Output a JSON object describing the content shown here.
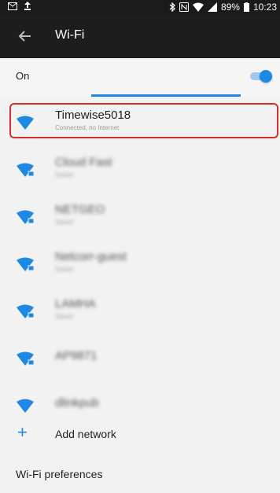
{
  "status_bar": {
    "battery": "89%",
    "time": "10:23",
    "icons": [
      "gmail-icon",
      "upload-icon",
      "bluetooth-icon",
      "nfc-icon",
      "wifi-icon",
      "signal-icon",
      "battery-icon"
    ]
  },
  "app_bar": {
    "title": "Wi-Fi",
    "back_icon": "arrow-back-icon"
  },
  "toggle_row": {
    "label": "On",
    "enabled": true
  },
  "networks": [
    {
      "ssid": "Timewise5018",
      "status": "Connected, no Internet",
      "secured": false,
      "blurred": false
    },
    {
      "ssid": "Cloud Fast",
      "status": "Saved",
      "secured": true,
      "blurred": true
    },
    {
      "ssid": "NETGEO",
      "status": "Saved",
      "secured": true,
      "blurred": true
    },
    {
      "ssid": "Netcorr-guest",
      "status": "Saved",
      "secured": true,
      "blurred": true
    },
    {
      "ssid": "LAMHA",
      "status": "Saved",
      "secured": true,
      "blurred": true
    },
    {
      "ssid": "AP9871",
      "status": "",
      "secured": true,
      "blurred": true
    },
    {
      "ssid": "dlinkpub",
      "status": "",
      "secured": false,
      "blurred": true
    }
  ],
  "add_network": {
    "label": "Add network",
    "icon": "plus-icon"
  },
  "preferences": {
    "label": "Wi-Fi preferences"
  },
  "colors": {
    "accent": "#1e88e5",
    "highlight": "#d32f2f",
    "app_bar": "#1d1d1d"
  }
}
